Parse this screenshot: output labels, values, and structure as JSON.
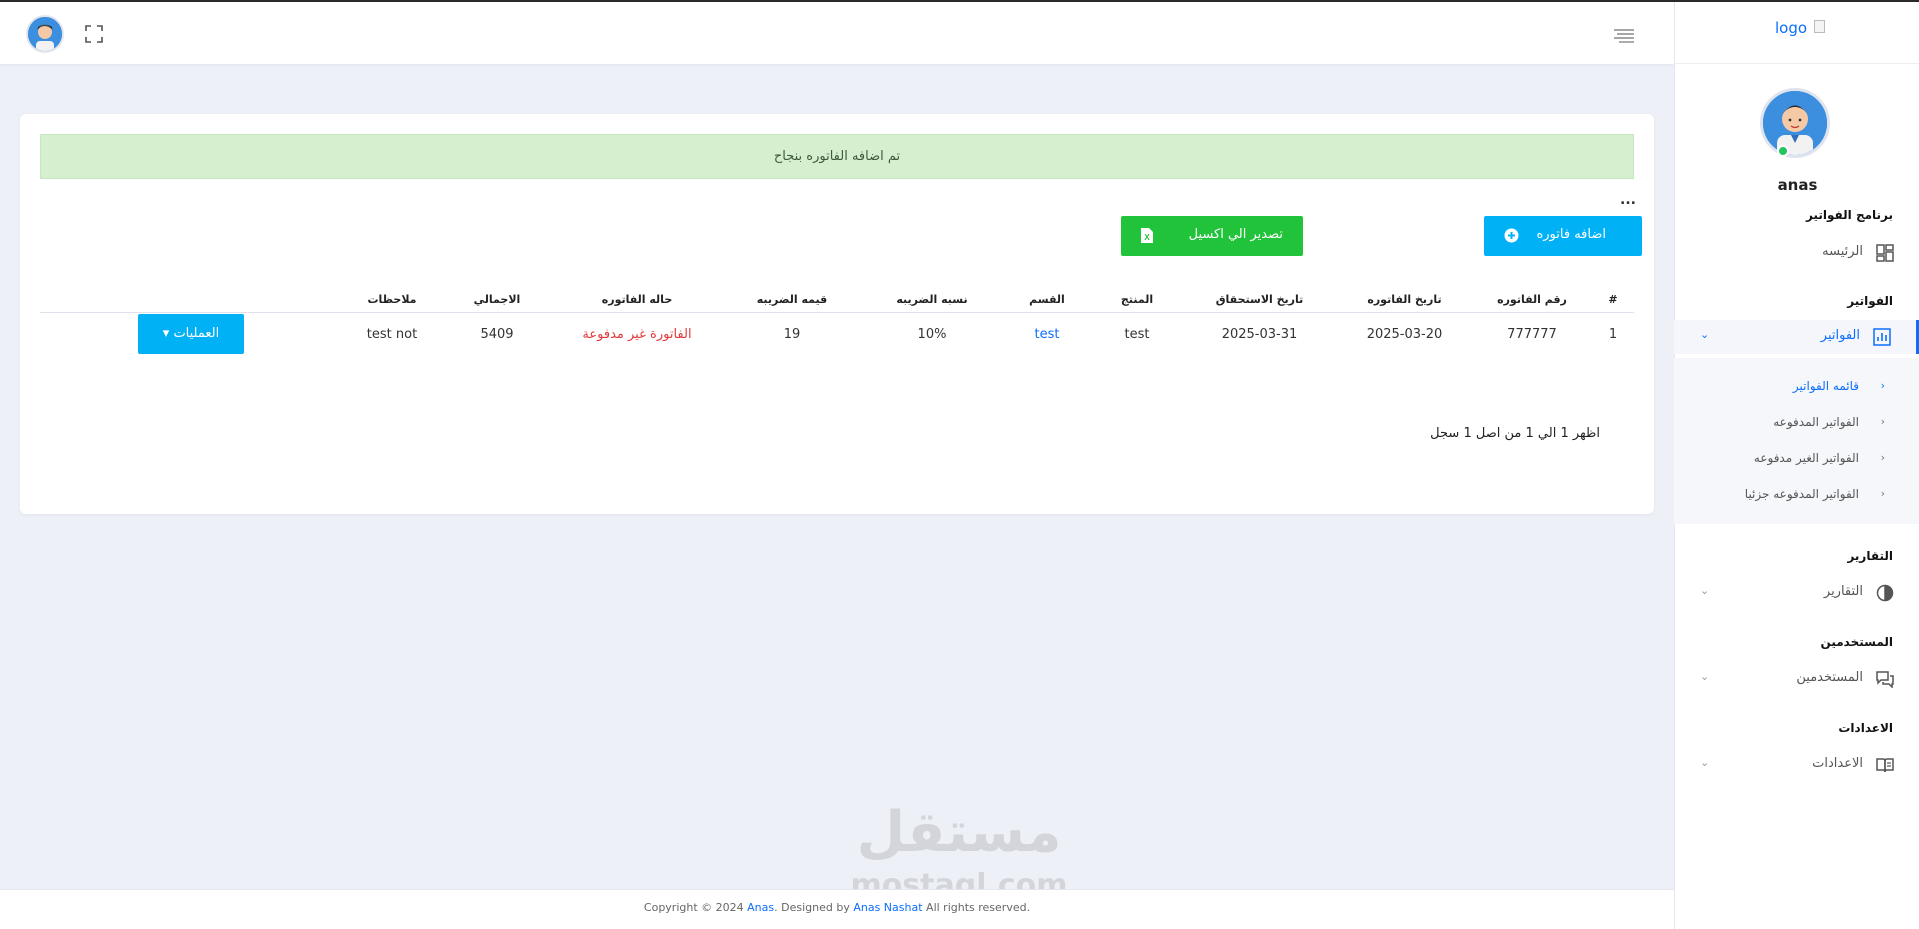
{
  "sidebar": {
    "logo_alt": "logo",
    "user_name": "anas",
    "sections": {
      "app": "برنامج الفواتير",
      "invoices": "الفواتير",
      "reports": "التقارير",
      "users": "المستخدمين",
      "settings": "الاعدادات"
    },
    "items": {
      "home": "الرئيسه",
      "invoices": "الفواتير",
      "reports": "التقارير",
      "users": "المستخدمين",
      "settings": "الاعدادات"
    },
    "submenu": [
      {
        "label": "قائمه الفواتير",
        "active": true
      },
      {
        "label": "الفواتير المدفوعه",
        "active": false
      },
      {
        "label": "الفواتير الغير مدفوعه",
        "active": false
      },
      {
        "label": "الفواتير المدفوعه جزئيا",
        "active": false
      }
    ]
  },
  "main": {
    "alert": "تم اضافه الفاتوره بنجاح",
    "more": "...",
    "add_button": "اضافه فاتوره",
    "export_button": "تصدير الي اكسيل",
    "excel_icon_letter": "X",
    "table": {
      "headers": [
        "#",
        "رقم الفاتوره",
        "تاريخ الفاتوره",
        "تاريخ الاستحقاق",
        "المنتج",
        "القسم",
        "نسبه الضريبه",
        "قيمه الضريبه",
        "حاله الفاتوره",
        "الاجمالي",
        "ملاحظات",
        ""
      ],
      "rows": [
        {
          "index": "1",
          "number": "777777",
          "date": "2025-03-20",
          "due_date": "2025-03-31",
          "product": "test",
          "section": "test",
          "tax_rate": "10%",
          "tax_value": "19",
          "status": "الفاتورة غير مدفوعة",
          "total": "5409",
          "notes": "test not",
          "actions_label": "العمليات"
        }
      ]
    },
    "pager_info": "اظهر 1 الي 1 من اصل 1 سجل"
  },
  "watermark": {
    "arabic": "مستقل",
    "latin": "mostaql.com"
  },
  "footer": {
    "prefix": "Copyright © 2024",
    "owner": "Anas",
    "designed_by": ". Designed by",
    "designer": "Anas Nashat",
    "suffix": "All rights reserved."
  },
  "colors": {
    "primary": "#0d6efd",
    "cyan_button": "#00b2f5",
    "green_button": "#21c33b",
    "alert_bg": "#d5efcf",
    "danger_text": "#e03a3a",
    "page_bg": "#eef0f8"
  }
}
